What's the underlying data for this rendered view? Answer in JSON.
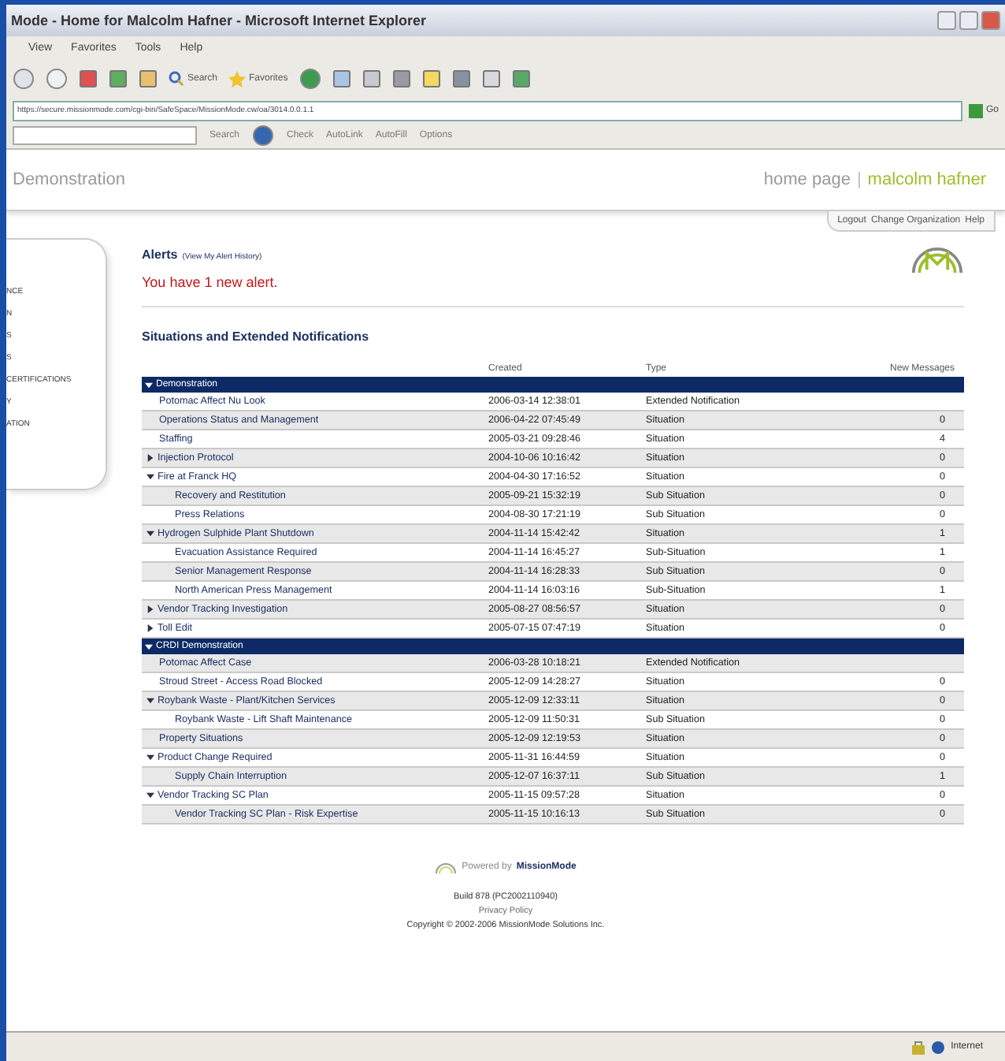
{
  "window": {
    "title": "Mode - Home for Malcolm Hafner - Microsoft Internet Explorer"
  },
  "menu": [
    "View",
    "Favorites",
    "Tools",
    "Help"
  ],
  "toolbar": {
    "search": "Search",
    "favorites": "Favorites"
  },
  "address": {
    "value": "https://secure.missionmode.com/cgi-bin/SafeSpace/MissionMode.cw/oa/3014.0.0.1.1",
    "go": "Go"
  },
  "google_bar": {
    "search": "Search",
    "check": "Check",
    "autolink": "AutoLink",
    "autofill": "AutoFill",
    "options": "Options"
  },
  "header": {
    "org": "Demonstration",
    "home": "home page",
    "separator": "|",
    "user": "malcolm hafner"
  },
  "top_links": [
    "Logout",
    "Change Organization",
    "Help"
  ],
  "sidebar": {
    "items": [
      "NCE",
      "N",
      "S",
      "S",
      "CERTIFICATIONS",
      "Y",
      "ATION"
    ]
  },
  "alerts": {
    "title": "Alerts",
    "history_link": "(View My Alert History)",
    "message": "You have 1 new alert."
  },
  "section_title": "Situations and Extended Notifications",
  "table": {
    "columns": [
      "",
      "Created",
      "Type",
      "New Messages"
    ],
    "groups": [
      {
        "name": "Demonstration",
        "expanded": true,
        "rows": [
          {
            "name": "Potomac Affect Nu Look",
            "created": "2006-03-14 12:38:01",
            "type": "Extended Notification",
            "messages": ""
          },
          {
            "name": "Operations Status and Management",
            "created": "2006-04-22 07:45:49",
            "type": "Situation",
            "messages": "0"
          },
          {
            "name": "Staffing",
            "created": "2005-03-21 09:28:46",
            "type": "Situation",
            "messages": "4"
          },
          {
            "name": "Injection Protocol",
            "created": "2004-10-06 10:16:42",
            "type": "Situation",
            "messages": "0",
            "expanded": false
          },
          {
            "name": "Fire at Franck HQ",
            "created": "2004-04-30 17:16:52",
            "type": "Situation",
            "messages": "0",
            "expanded": true,
            "children": [
              {
                "name": "Recovery and Restitution",
                "created": "2005-09-21 15:32:19",
                "type": "Sub Situation",
                "messages": "0"
              },
              {
                "name": "Press Relations",
                "created": "2004-08-30 17:21:19",
                "type": "Sub Situation",
                "messages": "0"
              }
            ]
          },
          {
            "name": "Hydrogen Sulphide Plant Shutdown",
            "created": "2004-11-14 15:42:42",
            "type": "Situation",
            "messages": "1",
            "expanded": true,
            "children": [
              {
                "name": "Evacuation Assistance Required",
                "created": "2004-11-14 16:45:27",
                "type": "Sub-Situation",
                "messages": "1"
              },
              {
                "name": "Senior Management Response",
                "created": "2004-11-14 16:28:33",
                "type": "Sub Situation",
                "messages": "0"
              },
              {
                "name": "North American Press Management",
                "created": "2004-11-14 16:03:16",
                "type": "Sub-Situation",
                "messages": "1"
              }
            ]
          },
          {
            "name": "Vendor Tracking Investigation",
            "created": "2005-08-27 08:56:57",
            "type": "Situation",
            "messages": "0",
            "expanded": false
          },
          {
            "name": "Toll Edit",
            "created": "2005-07-15 07:47:19",
            "type": "Situation",
            "messages": "0",
            "expanded": false
          }
        ]
      },
      {
        "name": "CRDI Demonstration",
        "expanded": true,
        "rows": [
          {
            "name": "Potomac Affect Case",
            "created": "2006-03-28 10:18:21",
            "type": "Extended Notification",
            "messages": ""
          },
          {
            "name": "Stroud Street - Access Road Blocked",
            "created": "2005-12-09 14:28:27",
            "type": "Situation",
            "messages": "0"
          },
          {
            "name": "Roybank Waste - Plant/Kitchen Services",
            "created": "2005-12-09 12:33:11",
            "type": "Situation",
            "messages": "0",
            "expanded": true,
            "children": [
              {
                "name": "Roybank Waste - Lift Shaft Maintenance",
                "created": "2005-12-09 11:50:31",
                "type": "Sub Situation",
                "messages": "0"
              }
            ]
          },
          {
            "name": "Property Situations",
            "created": "2005-12-09 12:19:53",
            "type": "Situation",
            "messages": "0"
          },
          {
            "name": "Product Change Required",
            "created": "2005-11-31 16:44:59",
            "type": "Situation",
            "messages": "0",
            "expanded": true,
            "children": [
              {
                "name": "Supply Chain Interruption",
                "created": "2005-12-07 16:37:11",
                "type": "Sub Situation",
                "messages": "1"
              }
            ]
          },
          {
            "name": "Vendor Tracking SC Plan",
            "created": "2005-11-15 09:57:28",
            "type": "Situation",
            "messages": "0",
            "expanded": true,
            "children": [
              {
                "name": "Vendor Tracking SC Plan - Risk Expertise",
                "created": "2005-11-15 10:16:13",
                "type": "Sub Situation",
                "messages": "0"
              }
            ]
          }
        ]
      }
    ]
  },
  "footer": {
    "powered": "Powered by",
    "brand": "MissionMode",
    "build": "Build 878 (PC2002110940)",
    "privacy": "Privacy Policy",
    "copyright": "Copyright © 2002-2006 MissionMode Solutions Inc."
  },
  "status_bar": {
    "zone": "Internet"
  }
}
